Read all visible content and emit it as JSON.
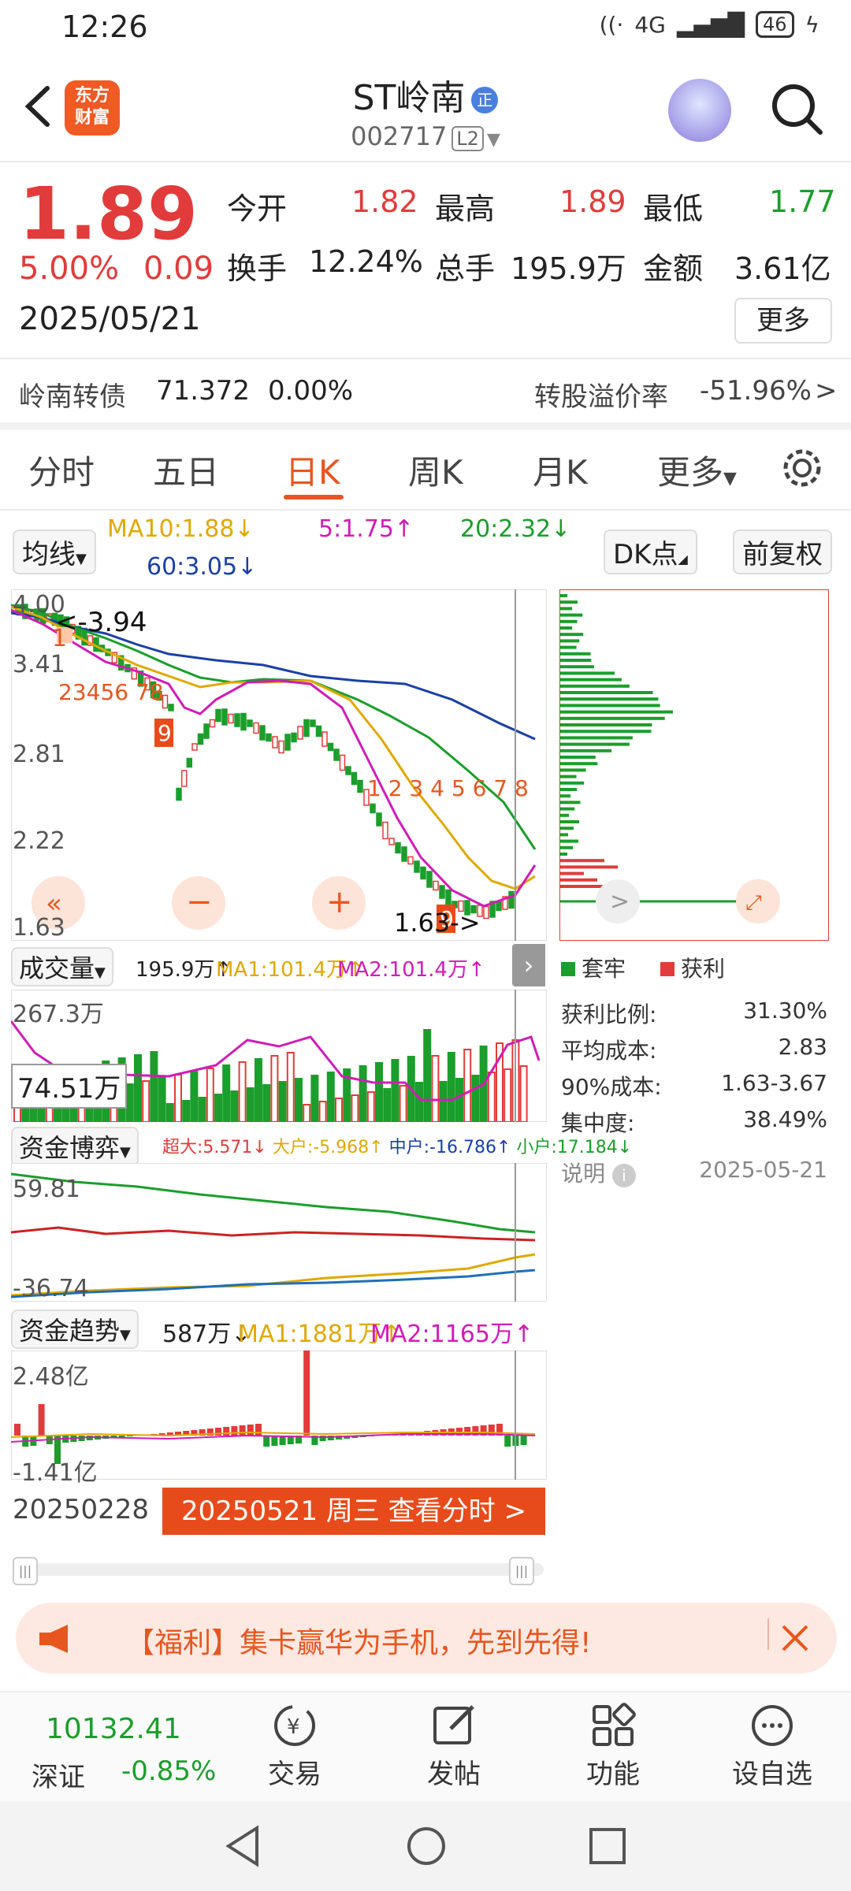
{
  "status": {
    "time": "12:26",
    "net": "4G",
    "battery": "46"
  },
  "header": {
    "logo": "东方\n财富",
    "title": "ST岭南",
    "badge": "正",
    "code": "002717",
    "level": "L2"
  },
  "quote": {
    "price": "1.89",
    "pct": "5.00%",
    "change": "0.09",
    "date": "2025/05/21",
    "open_label": "今开",
    "open": "1.82",
    "high_label": "最高",
    "high": "1.89",
    "low_label": "最低",
    "low": "1.77",
    "turnover_label": "换手",
    "turnover": "12.24%",
    "volume_label": "总手",
    "volume": "195.9万",
    "amount_label": "金额",
    "amount": "3.61亿",
    "more": "更多"
  },
  "convert": {
    "name": "岭南转债",
    "price": "71.372",
    "pct": "0.00%",
    "premium_label": "转股溢价率",
    "premium": "-51.96%",
    "arrow": ">"
  },
  "tabs": [
    "分时",
    "五日",
    "日K",
    "周K",
    "月K",
    "更多"
  ],
  "ma": {
    "selector": "均线",
    "ma10": "MA10:1.88↓",
    "ma5": "5:1.75↑",
    "ma20": "20:2.32↓",
    "ma60": "60:3.05↓",
    "dk": "DK点",
    "adjust": "前复权"
  },
  "kline": {
    "y_labels": [
      "4.00",
      "3.41",
      "2.81",
      "2.22",
      "1.63"
    ],
    "max_label": "3.94",
    "min_label": "1.63->",
    "nine_up": [
      "1",
      "2",
      "3",
      "4",
      "5",
      "6",
      "7",
      "8",
      "9"
    ],
    "nine_down": [
      "1",
      "2",
      "3",
      "4",
      "5",
      "6",
      "7",
      "8",
      "9"
    ]
  },
  "volume": {
    "selector": "成交量",
    "value": "195.9万↑",
    "ma1": "MA1:101.4万↑",
    "ma2": "MA2:101.4万↑",
    "top": "267.3万",
    "cursor": "74.51万"
  },
  "capital_game": {
    "selector": "资金博弈",
    "super": "超大:5.571↓",
    "large": "大户:-5.968↑",
    "mid": "中户:-16.786↑",
    "small": "小户:17.184↓",
    "top": "59.81",
    "bottom": "-36.74"
  },
  "capital_trend": {
    "selector": "资金趋势",
    "value": "587万↓",
    "ma1": "MA1:1881万↑",
    "ma2": "MA2:1165万↑",
    "top": "2.48亿",
    "bottom": "-1.41亿"
  },
  "dates": {
    "start": "20250228",
    "cta": "20250521 周三 查看分时 >"
  },
  "cost": {
    "legend_trap": "套牢",
    "legend_profit": "获利",
    "rows": [
      {
        "k": "获利比例:",
        "v": "31.30%"
      },
      {
        "k": "平均成本:",
        "v": "2.83"
      },
      {
        "k": "90%成本:",
        "v": "1.63-3.67"
      },
      {
        "k": "集中度:",
        "v": "38.49%"
      }
    ],
    "note": "说明",
    "note_date": "2025-05-21"
  },
  "promo": {
    "text": "【福利】集卡赢华为手机，先到先得!"
  },
  "bottom_nav": {
    "index_value": "10132.41",
    "index_name": "深证",
    "index_pct": "-0.85%",
    "items": [
      "交易",
      "发帖",
      "功能",
      "设自选"
    ]
  },
  "colors": {
    "up": "#e23b3b",
    "down": "#1b9e2b",
    "accent": "#e8561f",
    "ma5": "#d11cb7",
    "ma10": "#e0a800",
    "ma20": "#1b9e2b",
    "ma60": "#1a3fa8"
  }
}
